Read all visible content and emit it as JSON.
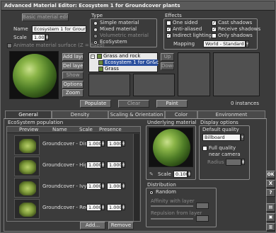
{
  "window": {
    "title": "Advanced Material Editor: Ecosystem 1 for Groundcover plants"
  },
  "top": {
    "basic_editor_label": "Basic material editor",
    "name_label": "Name",
    "name_value": "Ecosystem 1 for Groundco",
    "scale_label": "Scale",
    "scale_value": "1.00",
    "animate_label": "Animate material surface (Z = fixed)"
  },
  "type": {
    "title": "Type",
    "options": [
      "Simple material",
      "Mixed material",
      "Volumetric material",
      "EcoSystem"
    ],
    "selected": "EcoSystem"
  },
  "effects": {
    "title": "Effects",
    "checkboxes": [
      {
        "label": "One sided",
        "checked": false
      },
      {
        "label": "Cast shadows",
        "checked": true
      },
      {
        "label": "Anti-aliased",
        "checked": true
      },
      {
        "label": "Receive shadows",
        "checked": true
      },
      {
        "label": "Indirect lighting",
        "checked": true
      },
      {
        "label": "Only shadows",
        "checked": false
      }
    ],
    "mapping_label": "Mapping",
    "mapping_value": "World - Standard"
  },
  "layers": {
    "add_label": "Add layer",
    "del_label": "Del layer",
    "show_label": "Show",
    "options_label": "Options",
    "zoom_label": "Zoom",
    "tree": [
      "Grass and rock",
      "Ecosystem 1 for Gr&c",
      "Grass"
    ],
    "up_label": "Up",
    "down_label": "Down",
    "instances": "0 instances"
  },
  "actions": {
    "populate": "Populate",
    "clear": "Clear",
    "paint": "Paint"
  },
  "tabs": [
    "General",
    "Density",
    "Scaling & Orientation",
    "Color",
    "Environment"
  ],
  "population": {
    "title": "EcoSystem population",
    "headers": [
      "Preview",
      "Name",
      "Scale",
      "Presence"
    ],
    "rows": [
      {
        "name": "Groundcover - Discleaf",
        "scale": "1.000",
        "presence": "1.000"
      },
      {
        "name": "Groundcover - Highleaf",
        "scale": "1.000",
        "presence": "1.000"
      },
      {
        "name": "Groundcover - Ivy shiny",
        "scale": "1.000",
        "presence": "1.000"
      },
      {
        "name": "Groundcover - Redtip",
        "scale": "1.000",
        "presence": "1.000"
      }
    ],
    "add_label": "Add...",
    "remove_label": "Remove"
  },
  "underlying": {
    "title": "Underlying material",
    "scale_label": "Scale",
    "scale_value": "0.100"
  },
  "display": {
    "title": "Display options",
    "default_quality_label": "Default quality",
    "quality_value": "Billboard",
    "full_quality_label": "Full quality near camera",
    "radius_label": "Radius"
  },
  "distribution": {
    "title": "Distribution",
    "random_label": "Random",
    "affinity_label": "Affinity with layer",
    "repulsion_label": "Repulsion from layer"
  },
  "side": {
    "ok": "OK",
    "cancel": "X",
    "help": "?"
  }
}
